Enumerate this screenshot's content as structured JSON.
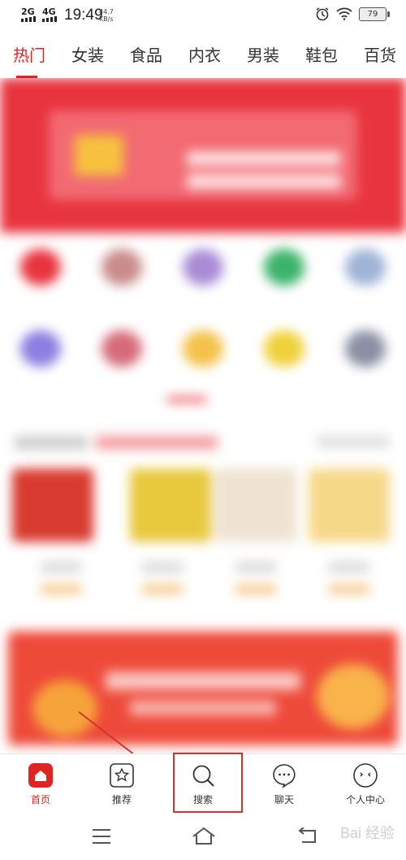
{
  "status_bar": {
    "network1": "2G",
    "network2": "4G",
    "time": "19:49",
    "speed_value": "44.7",
    "speed_unit": "KB/s",
    "battery": "79"
  },
  "categories": [
    "热门",
    "女装",
    "食品",
    "内衣",
    "男装",
    "鞋包",
    "百货"
  ],
  "active_category": "热门",
  "bottom_nav": {
    "home": "首页",
    "recommend": "推荐",
    "search": "搜索",
    "chat": "聊天",
    "profile": "个人中心"
  },
  "watermark": "Bai 经验",
  "colors": {
    "accent": "#e02424",
    "annotation": "#d9342b"
  }
}
